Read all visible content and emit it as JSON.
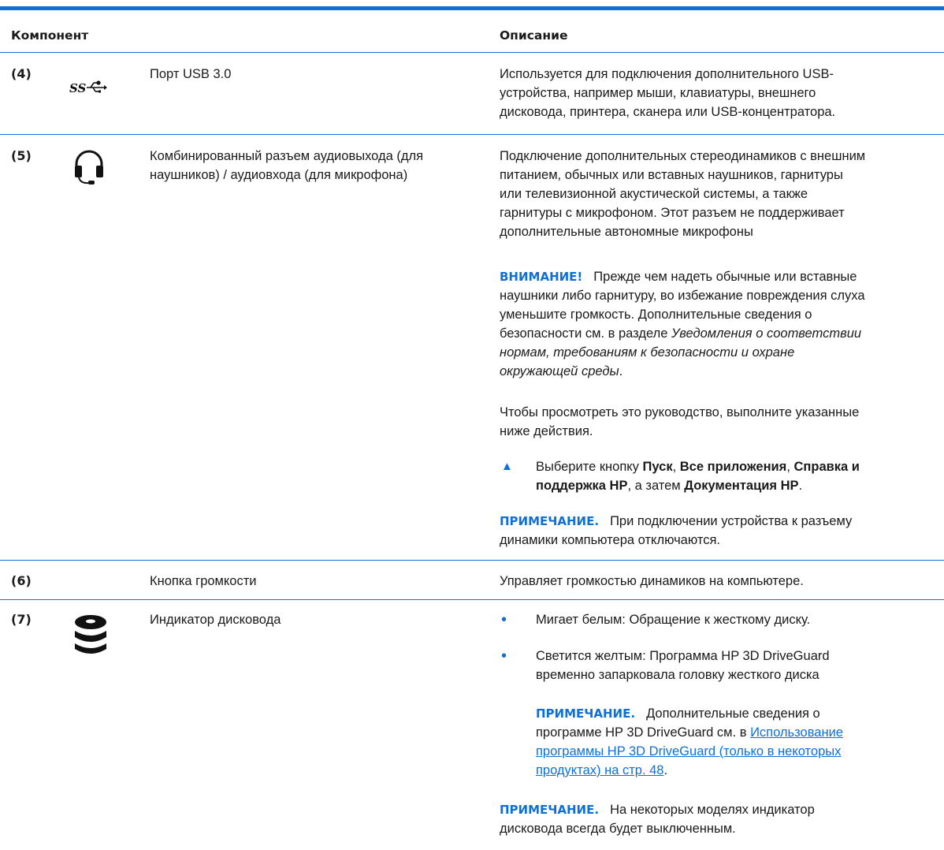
{
  "header": {
    "component": "Компонент",
    "description": "Описание"
  },
  "rows": [
    {
      "num": "(4)",
      "icon": "usb-superspeed-icon",
      "name": "Порт USB 3.0",
      "desc": [
        "Используется для подключения дополнительного USB-",
        "устройства, например мыши, клавиатуры, внешнего",
        "дисковода, принтера, сканера или USB-концентратора."
      ]
    },
    {
      "num": "(5)",
      "icon": "headphone-icon",
      "name": [
        "Комбинированный разъем аудиовыхода (для",
        "наушников) / аудиовхода (для микрофона)"
      ],
      "desc": [
        "Подключение дополнительных стереодинамиков с внешним",
        "питанием, обычных или вставных наушников, гарнитуры",
        "или телевизионной акустической системы, а также",
        "гарнитуры с микрофоном. Этот разъем не поддерживает",
        "дополнительные автономные микрофоны"
      ],
      "warning": {
        "label": "ВНИМАНИЕ!",
        "l1": "Прежде чем надеть обычные или вставные",
        "l2": "наушники либо гарнитуру, во избежание повреждения слуха",
        "l3": "уменьшите громкость. Дополнительные сведения о",
        "l4a": "безопасности см. в разделе ",
        "l4b": "Уведомления о соответствии",
        "l5": "нормам, требованиям к безопасности и охране",
        "l6": "окружающей среды",
        "l6end": "."
      },
      "guide": [
        "Чтобы просмотреть это руководство, выполните указанные",
        "ниже действия."
      ],
      "step": {
        "t1": "Выберите кнопку ",
        "b1": "Пуск",
        "c1": ", ",
        "b2": "Все приложения",
        "c2": ", ",
        "b3": "Справка и",
        "b4": "поддержка HP",
        "t2": ", а затем ",
        "b5": "Документация HP",
        "end": "."
      },
      "note": {
        "label": "ПРИМЕЧАНИЕ.",
        "l1": "При подключении устройства к разъему",
        "l2": "динамики компьютера отключаются."
      }
    },
    {
      "num": "(6)",
      "name": "Кнопка громкости",
      "desc": "Управляет громкостью динамиков на компьютере."
    },
    {
      "num": "(7)",
      "icon": "drive-indicator-icon",
      "name": "Индикатор дисковода",
      "bullets": [
        [
          "Мигает белым: Обращение к жесткому диску."
        ],
        [
          "Светится желтым: Программа HP 3D DriveGuard",
          "временно запарковала головку жесткого диска"
        ]
      ],
      "inner_note": {
        "label": "ПРИМЕЧАНИЕ.",
        "l1": "Дополнительные сведения о",
        "l2": "программе HP 3D DriveGuard см. в ",
        "link1": "Использование",
        "link2": "программы HP 3D DriveGuard (только в некоторых",
        "link3": "продуктах) на стр. 48",
        "end": "."
      },
      "note": {
        "label": "ПРИМЕЧАНИЕ.",
        "l1": "На некоторых моделях индикатор",
        "l2": "дисковода всегда будет выключенным."
      }
    }
  ]
}
